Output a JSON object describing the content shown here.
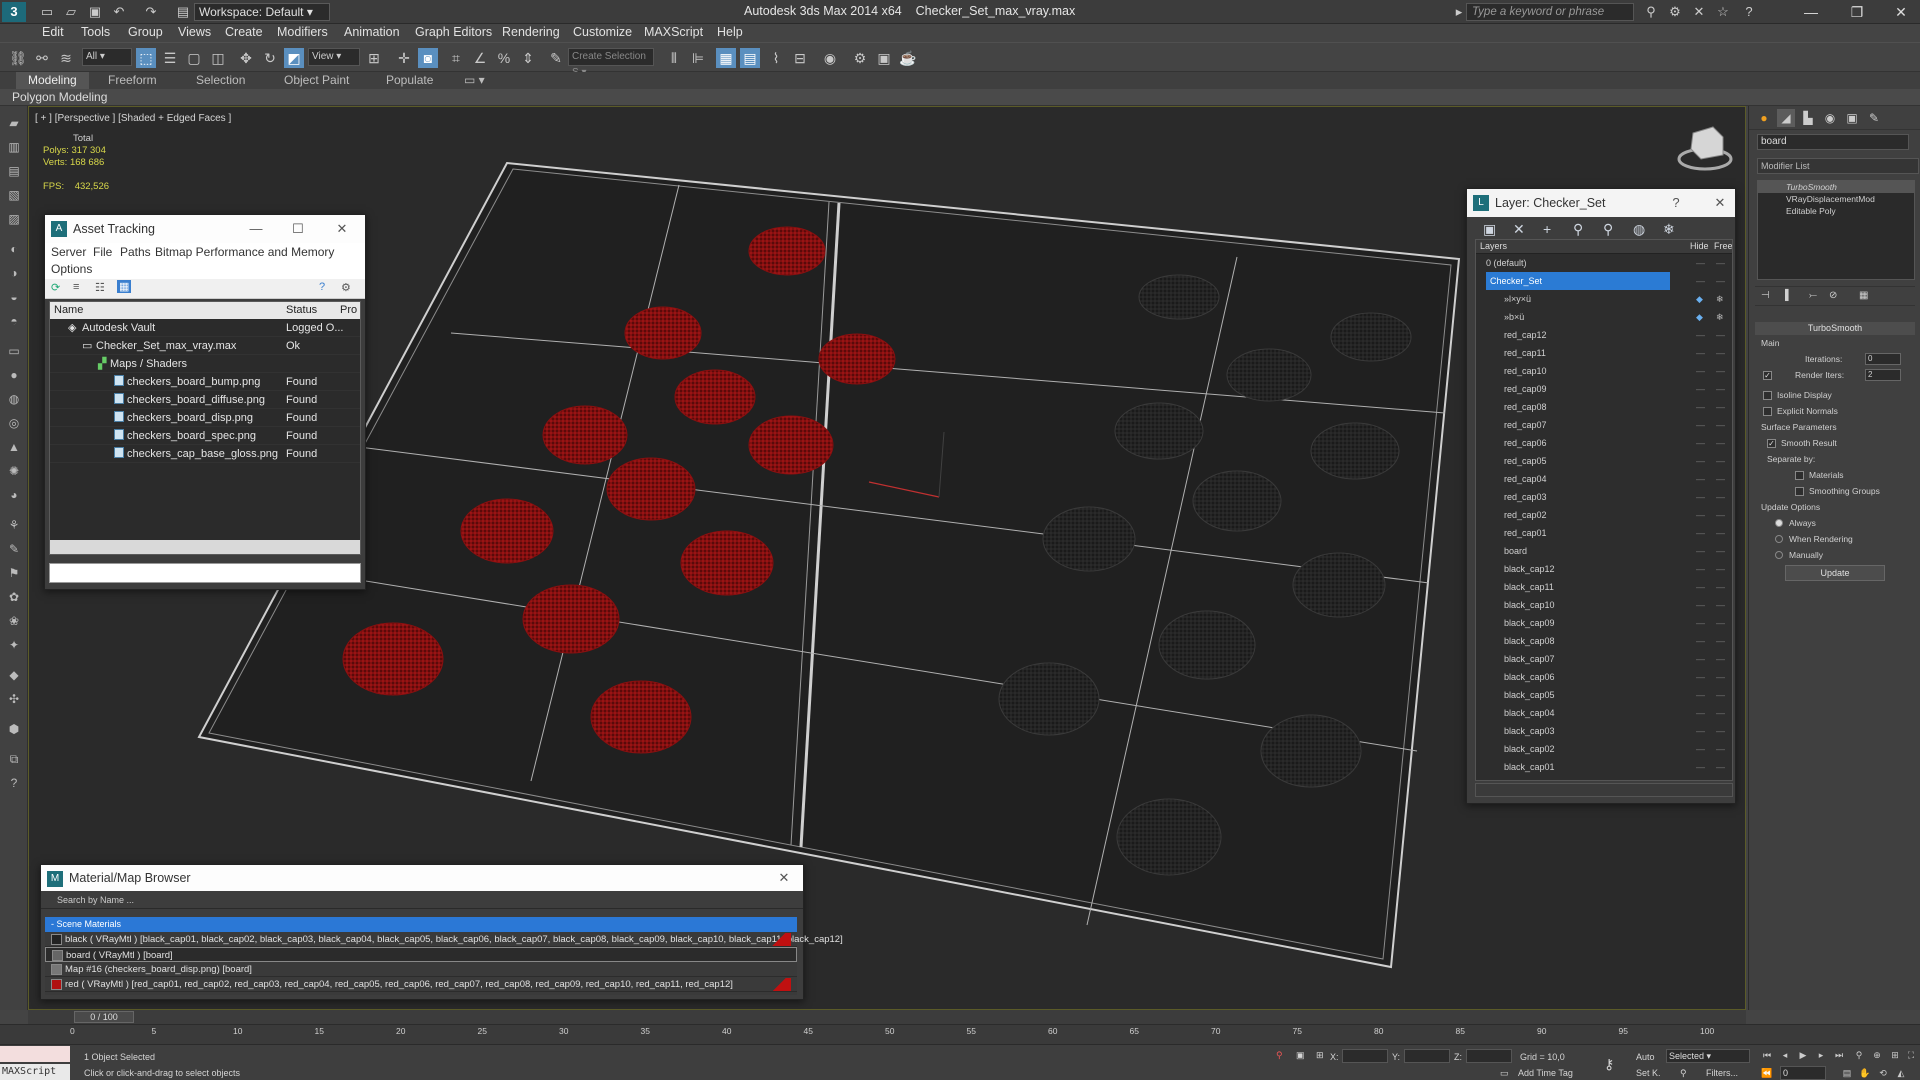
{
  "titlebar": {
    "workspace": "Workspace: Default",
    "app_title": "Autodesk 3ds Max  2014 x64",
    "file_title": "Checker_Set_max_vray.max",
    "search_placeholder": "Type a keyword or phrase"
  },
  "menu": [
    "Edit",
    "Tools",
    "Group",
    "Views",
    "Create",
    "Modifiers",
    "Animation",
    "Graph Editors",
    "Rendering",
    "Customize",
    "MAXScript",
    "Help"
  ],
  "toolbar": {
    "filter_value": "All",
    "refcoord_value": "View",
    "selection_set_placeholder": "Create Selection S"
  },
  "ribbon": {
    "tabs": [
      "Modeling",
      "Freeform",
      "Selection",
      "Object Paint",
      "Populate"
    ],
    "active_tab": "Modeling",
    "sub_label": "Polygon Modeling"
  },
  "viewport": {
    "label": "[ + ] [Perspective ] [Shaded + Edged Faces ]",
    "stats_total": "Total",
    "polys_label": "Polys:",
    "polys_value": "317 304",
    "verts_label": "Verts:",
    "verts_value": "168 686",
    "fps_label": "FPS:",
    "fps_value": "432,526"
  },
  "asset_tracking": {
    "title": "Asset Tracking",
    "menu": [
      "Server",
      "File",
      "Paths",
      "Bitmap Performance and Memory"
    ],
    "menu2": "Options",
    "columns": [
      "Name",
      "Status",
      "Pro"
    ],
    "rows": [
      {
        "name": "Autodesk Vault",
        "status": "Logged O..."
      },
      {
        "name": "Checker_Set_max_vray.max",
        "status": "Ok"
      },
      {
        "name": "Maps / Shaders",
        "status": ""
      },
      {
        "name": "checkers_board_bump.png",
        "status": "Found"
      },
      {
        "name": "checkers_board_diffuse.png",
        "status": "Found"
      },
      {
        "name": "checkers_board_disp.png",
        "status": "Found"
      },
      {
        "name": "checkers_board_spec.png",
        "status": "Found"
      },
      {
        "name": "checkers_cap_base_gloss.png",
        "status": "Found"
      }
    ]
  },
  "layer_window": {
    "title": "Layer: Checker_Set",
    "col_layers": "Layers",
    "col_hide": "Hide",
    "col_freeze": "Freez",
    "rows": [
      "0 (default)",
      "Checker_Set",
      "»l×y×ü",
      "»b×ü",
      "red_cap12",
      "red_cap11",
      "red_cap10",
      "red_cap09",
      "red_cap08",
      "red_cap07",
      "red_cap06",
      "red_cap05",
      "red_cap04",
      "red_cap03",
      "red_cap02",
      "red_cap01",
      "board",
      "black_cap12",
      "black_cap11",
      "black_cap10",
      "black_cap09",
      "black_cap08",
      "black_cap07",
      "black_cap06",
      "black_cap05",
      "black_cap04",
      "black_cap03",
      "black_cap02",
      "black_cap01"
    ],
    "selected": "Checker_Set"
  },
  "material_browser": {
    "title": "Material/Map Browser",
    "search": "Search by Name ...",
    "group": "- Scene Materials",
    "rows": [
      "black  ( VRayMtl ) [black_cap01, black_cap02, black_cap03, black_cap04, black_cap05, black_cap06, black_cap07, black_cap08, black_cap09, black_cap10, black_cap11, black_cap12]",
      "board  ( VRayMtl ) [board]",
      "Map #16 (checkers_board_disp.png) [board]",
      "red  ( VRayMtl ) [red_cap01, red_cap02, red_cap03, red_cap04, red_cap05, red_cap06, red_cap07, red_cap08, red_cap09, red_cap10, red_cap11, red_cap12]"
    ]
  },
  "command_panel": {
    "object_name": "board",
    "modifier_list": "Modifier List",
    "stack": [
      "TurboSmooth",
      "VRayDisplacementMod",
      "Editable Poly"
    ],
    "rollout_title": "TurboSmooth",
    "main_label": "Main",
    "iterations_label": "Iterations:",
    "iterations_value": "0",
    "render_iters_label": "Render Iters:",
    "render_iters_value": "2",
    "isoline": "Isoline Display",
    "explicit": "Explicit Normals",
    "surface_params": "Surface Parameters",
    "smooth_result": "Smooth Result",
    "separate_by": "Separate by:",
    "materials": "Materials",
    "smoothing_groups": "Smoothing Groups",
    "update_options": "Update Options",
    "always": "Always",
    "when_rendering": "When Rendering",
    "manually": "Manually",
    "update_button": "Update"
  },
  "timeline": {
    "slider": "0 / 100",
    "ticks": [
      "0",
      "5",
      "10",
      "15",
      "20",
      "25",
      "30",
      "35",
      "40",
      "45",
      "50",
      "55",
      "60",
      "65",
      "70",
      "75",
      "80",
      "85",
      "90",
      "95",
      "100"
    ]
  },
  "status": {
    "maxscript": "MAXScript",
    "selected_text": "1 Object Selected",
    "prompt": "Click or click-and-drag to select objects",
    "x_label": "X:",
    "y_label": "Y:",
    "z_label": "Z:",
    "grid": "Grid = 10,0",
    "add_time_tag": "Add Time Tag",
    "auto": "Auto",
    "selected_dd": "Selected",
    "set_k": "Set K.",
    "filters": "Filters...",
    "frame": "0"
  }
}
